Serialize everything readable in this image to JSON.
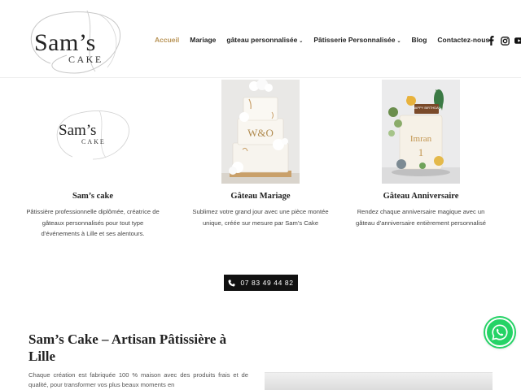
{
  "logo": {
    "brand": "Sam’s",
    "sub": "CAKE"
  },
  "nav": {
    "items": [
      {
        "label": "Accueil",
        "dropdown": false
      },
      {
        "label": "Mariage",
        "dropdown": false
      },
      {
        "label": "gâteau personnalisée",
        "dropdown": true
      },
      {
        "label": "Pâtisserie Personnalisée",
        "dropdown": true
      },
      {
        "label": "Blog",
        "dropdown": false
      },
      {
        "label": "Contactez-nous",
        "dropdown": false
      }
    ],
    "active_color": "#b89356",
    "caret": "⌄"
  },
  "social": {
    "icons": [
      "facebook-icon",
      "instagram-icon",
      "youtube-icon"
    ]
  },
  "columns": [
    {
      "title": "Sam’s cake",
      "text": "Pâtissière professionnelle diplômée, créatrice de gâteaux personnalisés pour tout type d’événements à Lille et ses alentours.",
      "logo_brand": "Sam’s",
      "logo_sub": "CAKE"
    },
    {
      "title": "Gâteau Mariage",
      "text": "Sublimez votre grand jour avec une pièce montée unique, créée sur mesure par Sam’s Cake",
      "topper": "W&O"
    },
    {
      "title": "Gâteau Anniversaire",
      "text": "Rendez chaque anniversaire magique avec un gâteau d’anniversaire entièrement personnalisé",
      "topper": "HAPPY BIRTHDAY",
      "cake_name": "Imran",
      "cake_number": "1"
    }
  ],
  "phone": {
    "number": "07 83 49 44 82"
  },
  "about": {
    "title": "Sam’s Cake – Artisan Pâtissière à Lille",
    "text": "Chaque création est fabriquée 100 % maison avec des produits frais et de qualité, pour transformer vos plus beaux moments en"
  },
  "colors": {
    "accent": "#b89356",
    "whatsapp": "#25d366",
    "button": "#111111"
  }
}
